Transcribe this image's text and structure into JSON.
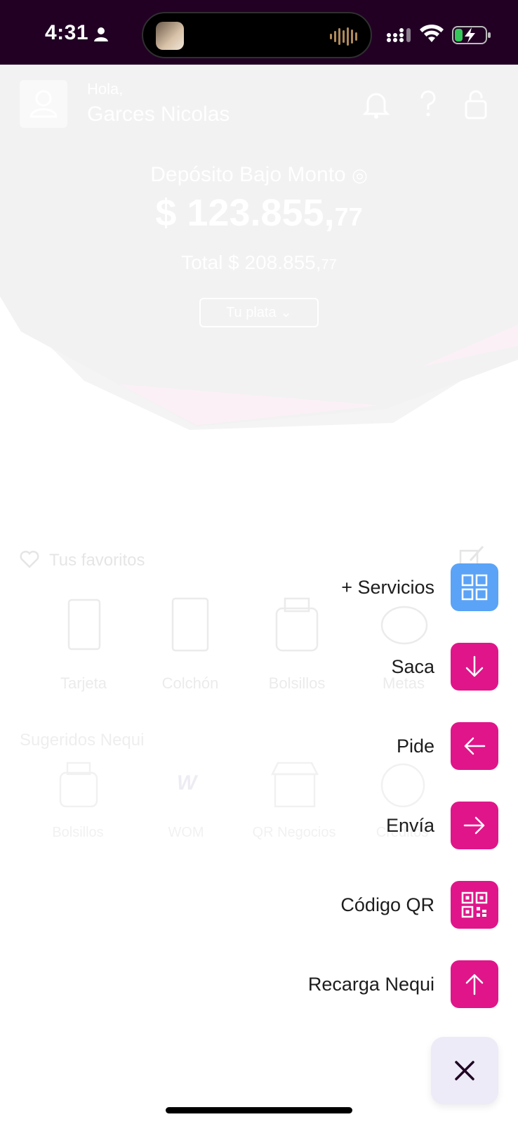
{
  "status_bar": {
    "time": "4:31"
  },
  "header": {
    "greeting": "Hola,",
    "user_name": "Garces Nicolas"
  },
  "balance": {
    "label": "Depósito Bajo Monto",
    "amount_main": "$ 123.855,",
    "amount_cents": "77",
    "total_main": "Total $ 208.855,",
    "total_cents": "77",
    "dropdown_label": "Tu plata"
  },
  "favorites": {
    "title": "Tus favoritos",
    "items": [
      "Tarjeta",
      "Colchón",
      "Bolsillos",
      "Metas"
    ]
  },
  "suggested": {
    "title": "Sugeridos Nequi",
    "items": [
      "Bolsillos",
      "WOM",
      "QR Negocios",
      "Créditos"
    ]
  },
  "action_menu": {
    "items": [
      {
        "label": "+ Servicios",
        "icon": "grid-icon",
        "color": "#5aa3f7"
      },
      {
        "label": "Saca",
        "icon": "arrow-down-icon",
        "color": "#e0158a"
      },
      {
        "label": "Pide",
        "icon": "arrow-left-icon",
        "color": "#e0158a"
      },
      {
        "label": "Envía",
        "icon": "arrow-right-icon",
        "color": "#e0158a"
      },
      {
        "label": "Código QR",
        "icon": "qr-code-icon",
        "color": "#e0158a"
      },
      {
        "label": "Recarga Nequi",
        "icon": "arrow-up-icon",
        "color": "#e0158a"
      }
    ],
    "close_icon": "close-icon"
  },
  "colors": {
    "status_bar_bg": "#210024",
    "accent_pink": "#e0158a",
    "accent_blue": "#5aa3f7"
  }
}
